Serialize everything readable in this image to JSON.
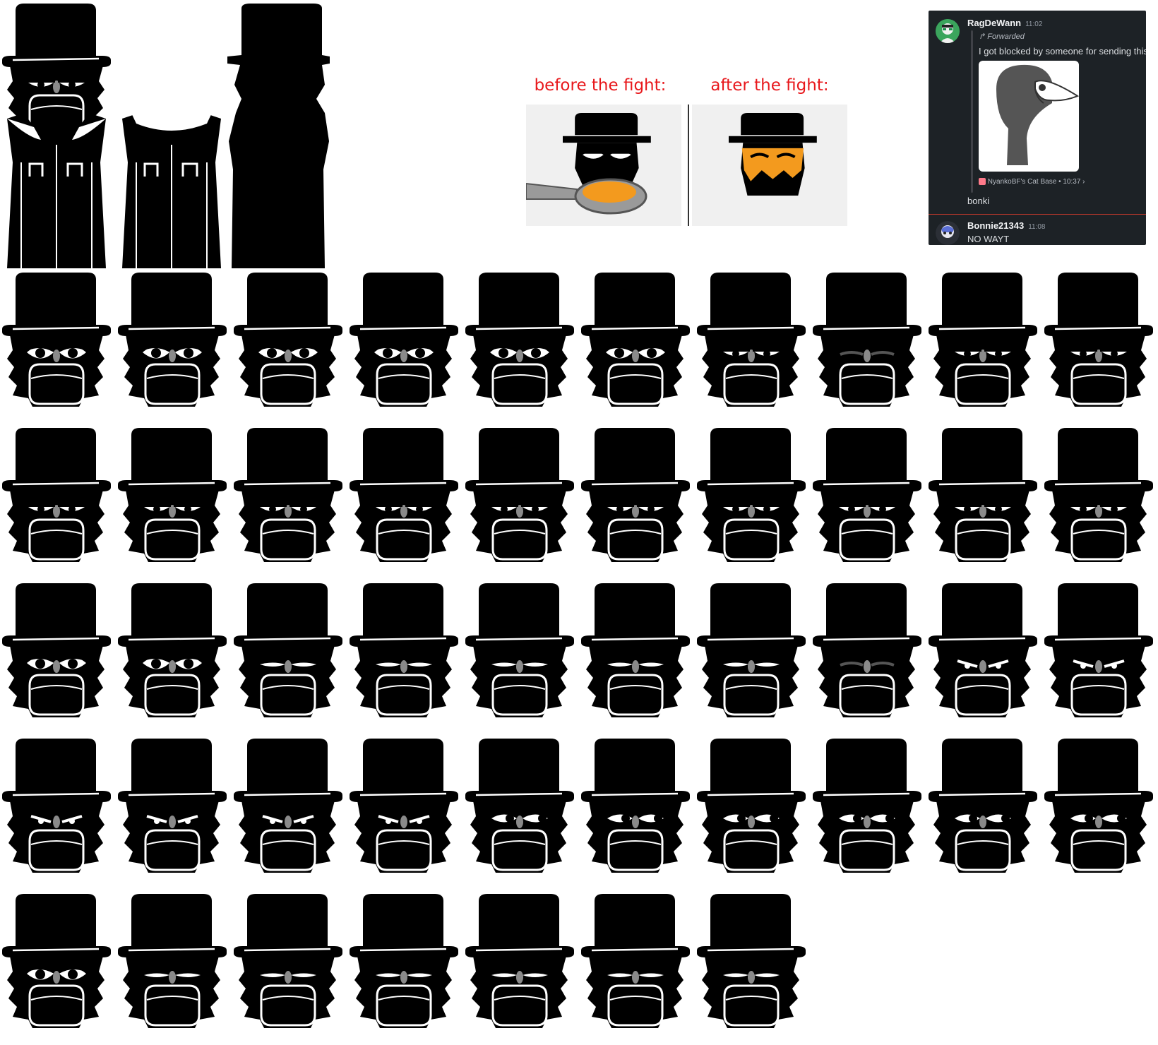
{
  "meme": {
    "before_caption": "before the fight:",
    "after_caption": "after the fight:"
  },
  "discord": {
    "message1": {
      "username": "RagDeWann",
      "time": "11:02",
      "forwarded_label": "Forwarded",
      "forwarded_text": "I got blocked by someone for sending this",
      "source_server": "NyankoBF's Cat Base",
      "source_time": "10:37",
      "reply": "bonki"
    },
    "message2": {
      "username": "Bonnie21343",
      "time": "11:08",
      "text": "NO WAYT"
    },
    "colors": {
      "background": "#1d2226",
      "separator": "#c0392b",
      "avatar1": "#3ba55d"
    }
  },
  "sprite_sheet": {
    "rows": [
      10,
      10,
      10,
      10,
      7
    ],
    "body_parts": [
      "coat-open-collar",
      "coat-no-head",
      "silhouette-full"
    ]
  }
}
